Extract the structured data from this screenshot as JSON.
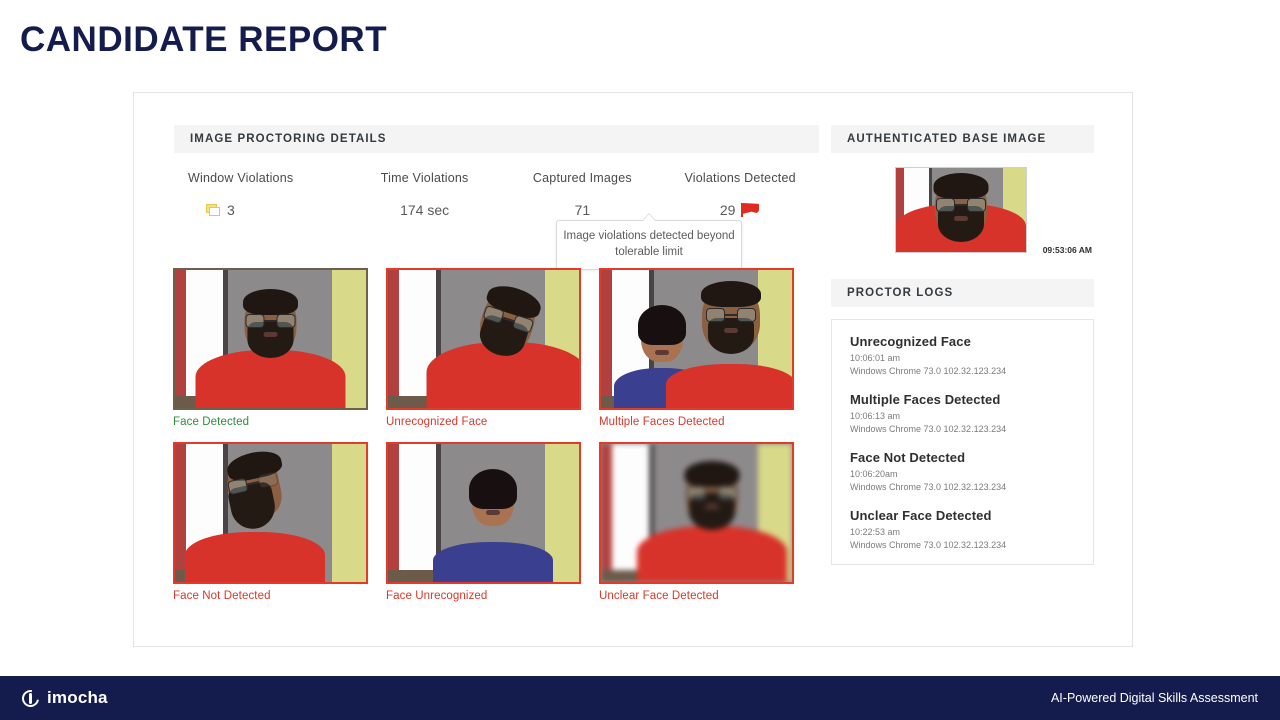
{
  "slide": {
    "title": "CANDIDATE REPORT",
    "title_color": "#141b4d"
  },
  "proctoring": {
    "section_title": "IMAGE PROCTORING DETAILS",
    "stats": [
      {
        "label": "Window Violations",
        "value": "3",
        "icon": "windows-copy-icon"
      },
      {
        "label": "Time Violations",
        "value": "174 sec",
        "icon": ""
      },
      {
        "label": "Captured Images",
        "value": "71",
        "icon": ""
      },
      {
        "label": "Violations Detected",
        "value": "29",
        "icon": "red-flag-icon"
      }
    ],
    "tooltip": "Image violations detected beyond tolerable limit"
  },
  "captures": {
    "items": [
      {
        "caption": "Face Detected",
        "status": "ok",
        "flagged": false,
        "scene": "front"
      },
      {
        "caption": "Unrecognized Face",
        "status": "bad",
        "flagged": true,
        "scene": "lookdown"
      },
      {
        "caption": "Multiple Faces Detected",
        "status": "bad",
        "flagged": true,
        "scene": "two"
      },
      {
        "caption": "Face Not Detected",
        "status": "bad",
        "flagged": true,
        "scene": "profile"
      },
      {
        "caption": "Face Unrecognized",
        "status": "bad",
        "flagged": true,
        "scene": "girl"
      },
      {
        "caption": "Unclear Face Detected",
        "status": "bad",
        "flagged": true,
        "scene": "blur"
      }
    ]
  },
  "base_image": {
    "section_title": "AUTHENTICATED BASE IMAGE",
    "timestamp": "09:53:06 AM"
  },
  "proctor_logs": {
    "section_title": "PROCTOR LOGS",
    "entries": [
      {
        "title": "Unrecognized Face",
        "time": "10:06:01 am",
        "meta": "Windows Chrome 73.0 102.32.123.234"
      },
      {
        "title": "Multiple Faces Detected",
        "time": "10:06:13 am",
        "meta": "Windows Chrome 73.0 102.32.123.234"
      },
      {
        "title": "Face Not Detected",
        "time": "10:06:20am",
        "meta": "Windows Chrome 73.0 102.32.123.234"
      },
      {
        "title": "Unclear Face Detected",
        "time": "10:22:53 am",
        "meta": "Windows Chrome 73.0 102.32.123.234"
      }
    ]
  },
  "footer": {
    "brand": "imocha",
    "tagline": "AI-Powered Digital Skills Assessment",
    "background": "#141b4d"
  },
  "colors": {
    "accent_red": "#d4392b",
    "accent_green": "#2e8b3d",
    "panel_head_bg": "#f4f4f4"
  }
}
